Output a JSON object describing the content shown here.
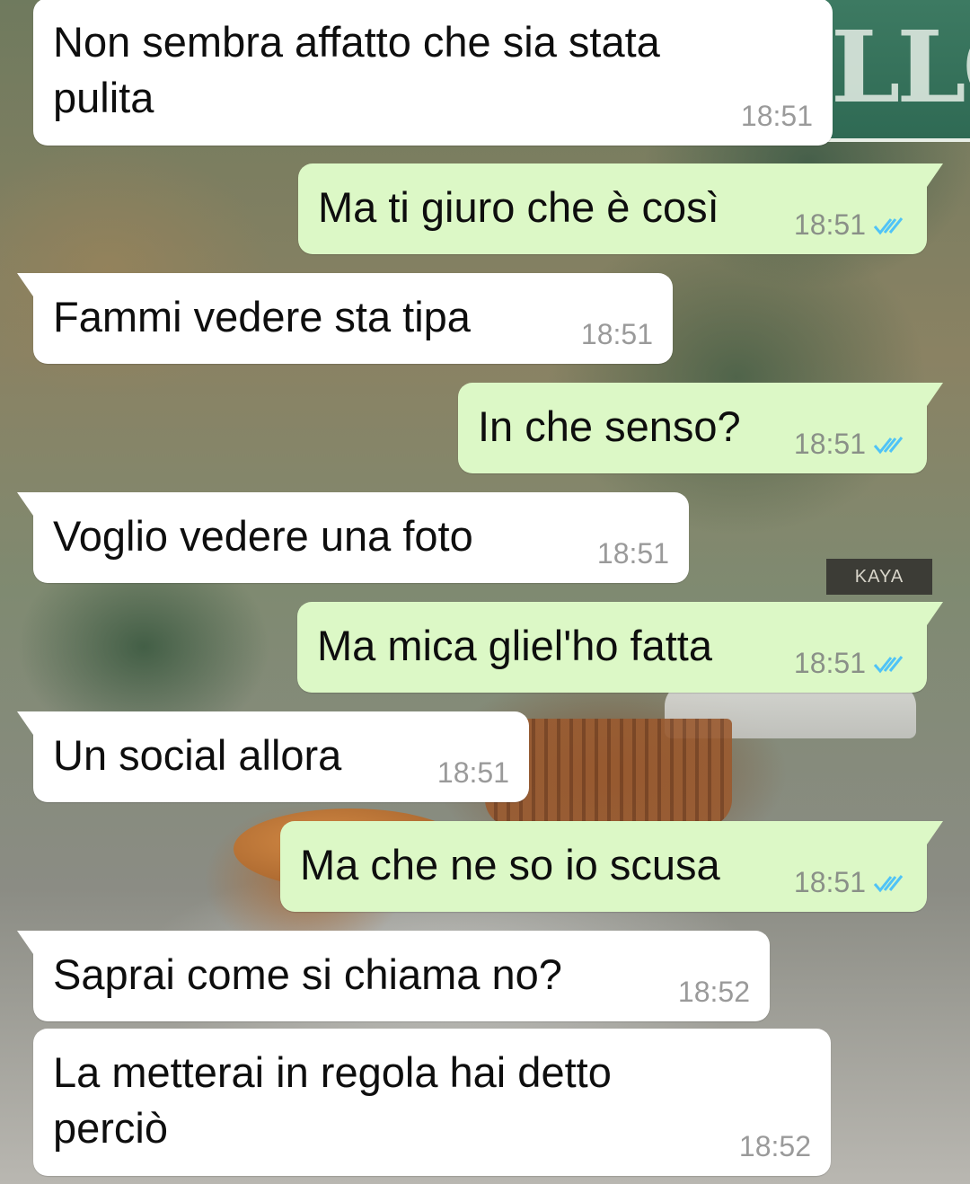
{
  "background": {
    "street_sign_text": "LLOW",
    "shop_sign_text": "KAYA"
  },
  "colors": {
    "incoming_bubble": "#ffffff",
    "outgoing_bubble": "#dcf8c6",
    "read_tick": "#4fc3f7",
    "timestamp": "#8a9088"
  },
  "messages": [
    {
      "direction": "incoming",
      "text": "Non sembra affatto che sia stata\npulita",
      "time": "18:51",
      "read_icon": null
    },
    {
      "direction": "outgoing",
      "text": "Ma ti giuro che è così",
      "time": "18:51",
      "read_icon": "double-check-icon"
    },
    {
      "direction": "incoming",
      "text": "Fammi vedere sta tipa",
      "time": "18:51",
      "read_icon": null
    },
    {
      "direction": "outgoing",
      "text": "In che senso?",
      "time": "18:51",
      "read_icon": "double-check-icon"
    },
    {
      "direction": "incoming",
      "text": "Voglio vedere una foto",
      "time": "18:51",
      "read_icon": null
    },
    {
      "direction": "outgoing",
      "text": "Ma mica gliel'ho fatta",
      "time": "18:51",
      "read_icon": "double-check-icon"
    },
    {
      "direction": "incoming",
      "text": "Un social allora",
      "time": "18:51",
      "read_icon": null
    },
    {
      "direction": "outgoing",
      "text": "Ma che ne so io scusa",
      "time": "18:51",
      "read_icon": "double-check-icon"
    },
    {
      "direction": "incoming",
      "text": "Saprai come si chiama no?",
      "time": "18:52",
      "read_icon": null
    },
    {
      "direction": "incoming",
      "text": "La metterai in regola hai detto\nperciò",
      "time": "18:52",
      "read_icon": null
    }
  ]
}
